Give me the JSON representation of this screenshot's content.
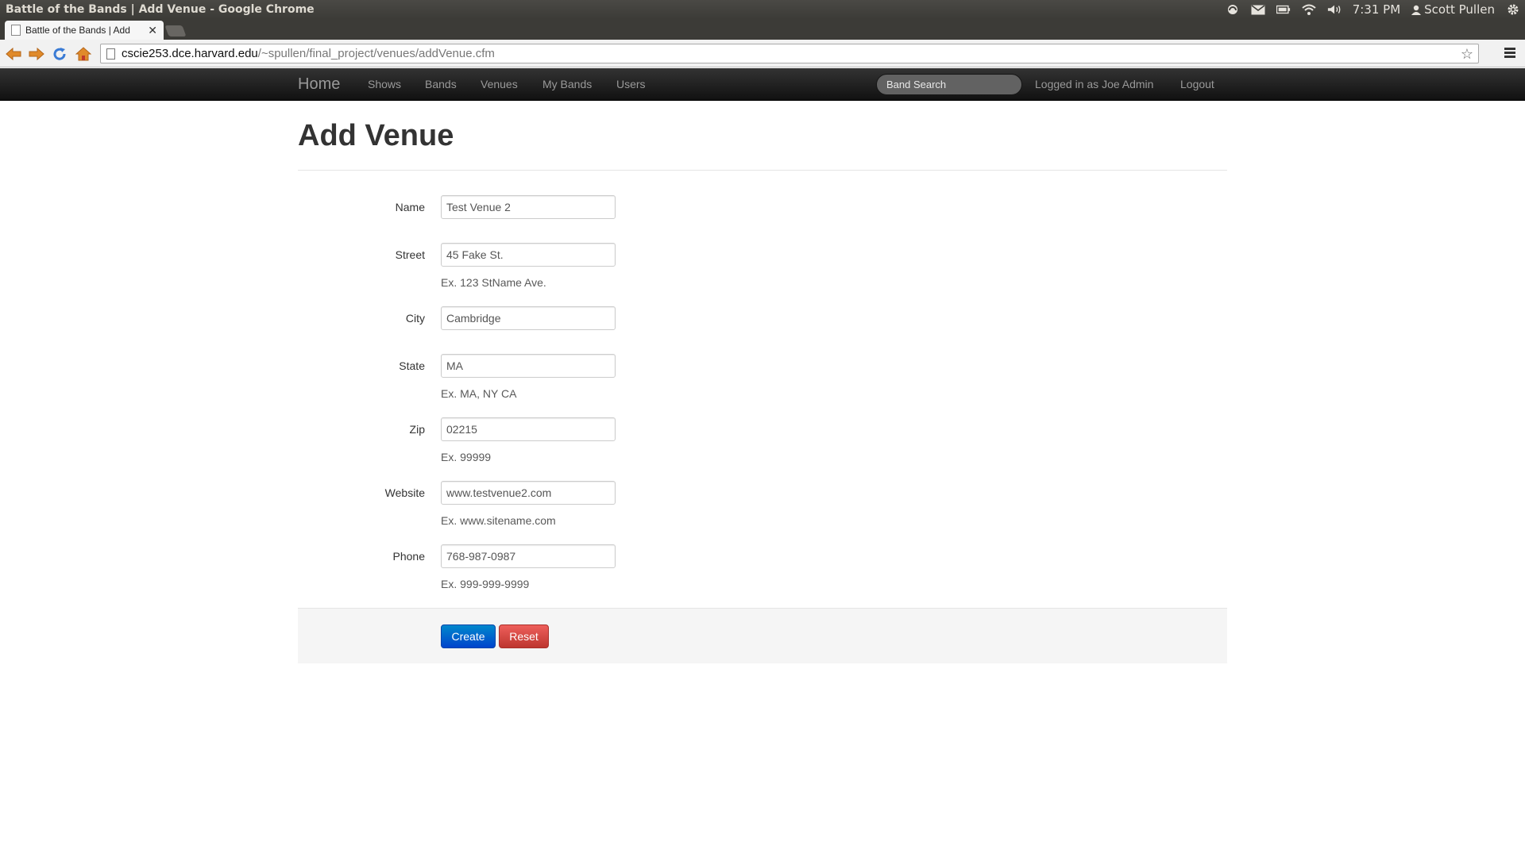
{
  "os": {
    "window_title": "Battle of the Bands | Add Venue - Google Chrome",
    "clock": "7:31 PM",
    "user": "Scott Pullen"
  },
  "browser": {
    "tab_title": "Battle of the Bands | Add",
    "url_host": "cscie253.dce.harvard.edu",
    "url_path": "/~spullen/final_project/venues/addVenue.cfm"
  },
  "navbar": {
    "brand": "Home",
    "links": [
      "Shows",
      "Bands",
      "Venues",
      "My Bands",
      "Users"
    ],
    "search_placeholder": "Band Search",
    "logged_in": "Logged in as Joe Admin",
    "logout": "Logout"
  },
  "page": {
    "title": "Add Venue"
  },
  "form": {
    "fields": [
      {
        "label": "Name",
        "value": "Test Venue 2",
        "help": ""
      },
      {
        "label": "Street",
        "value": "45 Fake St.",
        "help": "Ex. 123 StName Ave."
      },
      {
        "label": "City",
        "value": "Cambridge",
        "help": ""
      },
      {
        "label": "State",
        "value": "MA",
        "help": "Ex. MA, NY CA"
      },
      {
        "label": "Zip",
        "value": "02215",
        "help": "Ex. 99999"
      },
      {
        "label": "Website",
        "value": "www.testvenue2.com",
        "help": "Ex. www.sitename.com"
      },
      {
        "label": "Phone",
        "value": "768-987-0987",
        "help": "Ex. 999-999-9999"
      }
    ],
    "create_label": "Create",
    "reset_label": "Reset"
  },
  "colors": {
    "primary_button": "#0055cc",
    "danger_button": "#da4f49",
    "navbar": "#1b1b1b"
  }
}
